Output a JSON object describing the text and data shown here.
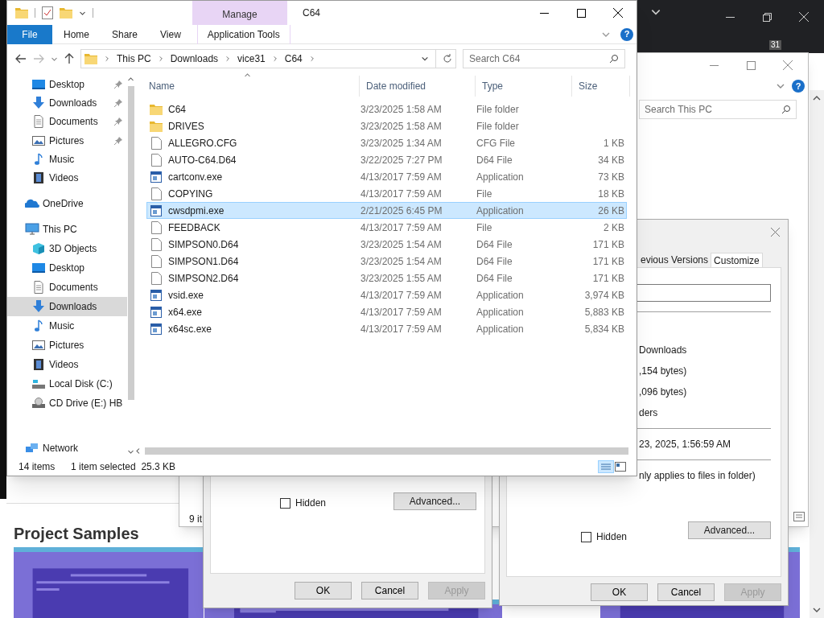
{
  "browser": {
    "badge": "31",
    "page_heading": "Project Samples"
  },
  "back_explorer": {
    "search": {
      "placeholder": "Search This PC"
    },
    "help": "?",
    "status": "9 it"
  },
  "dialog_right": {
    "tabs": [
      {
        "label": "evious Versions",
        "selected": false
      },
      {
        "label": "Customize",
        "selected": true
      }
    ],
    "fields": [
      {
        "kind": "text",
        "value": "Downloads"
      },
      {
        "kind": "text",
        "value": ",154 bytes)"
      },
      {
        "kind": "text",
        "value": ",096 bytes)"
      },
      {
        "kind": "text",
        "value": "ders"
      },
      {
        "kind": "rule"
      },
      {
        "kind": "text",
        "value": "23, 2025, 1:56:59 AM"
      },
      {
        "kind": "rule"
      },
      {
        "kind": "text",
        "value": "nly applies to files in folder)"
      }
    ],
    "hidden": {
      "label": "Hidden",
      "checked": false
    },
    "advanced": "Advanced...",
    "buttons": [
      {
        "label": "OK",
        "disabled": false
      },
      {
        "label": "Cancel",
        "disabled": false
      },
      {
        "label": "Apply",
        "disabled": true
      }
    ]
  },
  "dialog_left": {
    "hidden": {
      "label": "Hidden",
      "checked": false
    },
    "advanced": "Advanced...",
    "buttons": [
      {
        "label": "OK",
        "disabled": false
      },
      {
        "label": "Cancel",
        "disabled": false
      },
      {
        "label": "Apply",
        "disabled": true
      }
    ]
  },
  "explorer": {
    "title": "C64",
    "context_group": "Manage",
    "help": "?",
    "tabs": [
      {
        "label": "File",
        "kind": "file"
      },
      {
        "label": "Home",
        "kind": "tab"
      },
      {
        "label": "Share",
        "kind": "tab"
      },
      {
        "label": "View",
        "kind": "tab"
      },
      {
        "label": "Application Tools",
        "kind": "context"
      }
    ],
    "breadcrumbs": [
      "This PC",
      "Downloads",
      "vice31",
      "C64"
    ],
    "search": {
      "placeholder": "Search C64"
    },
    "nav": {
      "quick_access": [
        {
          "label": "Desktop",
          "kind": "desktop",
          "pinned": true
        },
        {
          "label": "Downloads",
          "kind": "download",
          "pinned": true
        },
        {
          "label": "Documents",
          "kind": "document",
          "pinned": true
        },
        {
          "label": "Pictures",
          "kind": "picture",
          "pinned": true
        },
        {
          "label": "Music",
          "kind": "music",
          "pinned": false
        },
        {
          "label": "Videos",
          "kind": "video",
          "pinned": false
        }
      ],
      "roots": [
        {
          "label": "OneDrive",
          "kind": "cloud",
          "selected": false
        },
        {
          "label": "This PC",
          "kind": "pc",
          "selected": false,
          "children": [
            {
              "label": "3D Objects",
              "kind": "cube",
              "selected": false
            },
            {
              "label": "Desktop",
              "kind": "desktop",
              "selected": false
            },
            {
              "label": "Documents",
              "kind": "document",
              "selected": false
            },
            {
              "label": "Downloads",
              "kind": "download",
              "selected": true
            },
            {
              "label": "Music",
              "kind": "music",
              "selected": false
            },
            {
              "label": "Pictures",
              "kind": "picture",
              "selected": false
            },
            {
              "label": "Videos",
              "kind": "video",
              "selected": false
            },
            {
              "label": "Local Disk (C:)",
              "kind": "disk",
              "selected": false
            },
            {
              "label": "CD Drive (E:) HB",
              "kind": "cd",
              "selected": false
            }
          ]
        },
        {
          "label": "Network",
          "kind": "network",
          "selected": false
        }
      ]
    },
    "columns": [
      "Name",
      "Date modified",
      "Type",
      "Size"
    ],
    "files": [
      {
        "name": "C64",
        "date": "3/23/2025 1:58 AM",
        "type": "File folder",
        "kind": "folder",
        "selected": false
      },
      {
        "name": "DRIVES",
        "date": "3/23/2025 1:58 AM",
        "type": "File folder",
        "kind": "folder",
        "selected": false
      },
      {
        "name": "ALLEGRO.CFG",
        "date": "3/23/2025 1:34 AM",
        "type": "CFG File",
        "size": "1 KB",
        "kind": "file",
        "selected": false
      },
      {
        "name": "AUTO-C64.D64",
        "date": "3/22/2025 7:27 PM",
        "type": "D64 File",
        "size": "34 KB",
        "kind": "file",
        "selected": false
      },
      {
        "name": "cartconv.exe",
        "date": "4/13/2017 7:59 AM",
        "type": "Application",
        "size": "73 KB",
        "kind": "app",
        "selected": false
      },
      {
        "name": "COPYING",
        "date": "4/13/2017 7:59 AM",
        "type": "File",
        "size": "18 KB",
        "kind": "file",
        "selected": false
      },
      {
        "name": "cwsdpmi.exe",
        "date": "2/21/2025 6:45 PM",
        "type": "Application",
        "size": "26 KB",
        "kind": "app",
        "selected": true
      },
      {
        "name": "FEEDBACK",
        "date": "4/13/2017 7:59 AM",
        "type": "File",
        "size": "2 KB",
        "kind": "file",
        "selected": false
      },
      {
        "name": "SIMPSON0.D64",
        "date": "3/23/2025 1:54 AM",
        "type": "D64 File",
        "size": "171 KB",
        "kind": "file",
        "selected": false
      },
      {
        "name": "SIMPSON1.D64",
        "date": "3/23/2025 1:54 AM",
        "type": "D64 File",
        "size": "171 KB",
        "kind": "file",
        "selected": false
      },
      {
        "name": "SIMPSON2.D64",
        "date": "3/23/2025 1:55 AM",
        "type": "D64 File",
        "size": "171 KB",
        "kind": "file",
        "selected": false
      },
      {
        "name": "vsid.exe",
        "date": "4/13/2017 7:59 AM",
        "type": "Application",
        "size": "3,974 KB",
        "kind": "app",
        "selected": false
      },
      {
        "name": "x64.exe",
        "date": "4/13/2017 7:59 AM",
        "type": "Application",
        "size": "5,883 KB",
        "kind": "app",
        "selected": false
      },
      {
        "name": "x64sc.exe",
        "date": "4/13/2017 7:59 AM",
        "type": "Application",
        "size": "5,834 KB",
        "kind": "app",
        "selected": false
      }
    ],
    "status": {
      "count": "14 items",
      "selection": "1 item selected  25.3 KB"
    }
  }
}
